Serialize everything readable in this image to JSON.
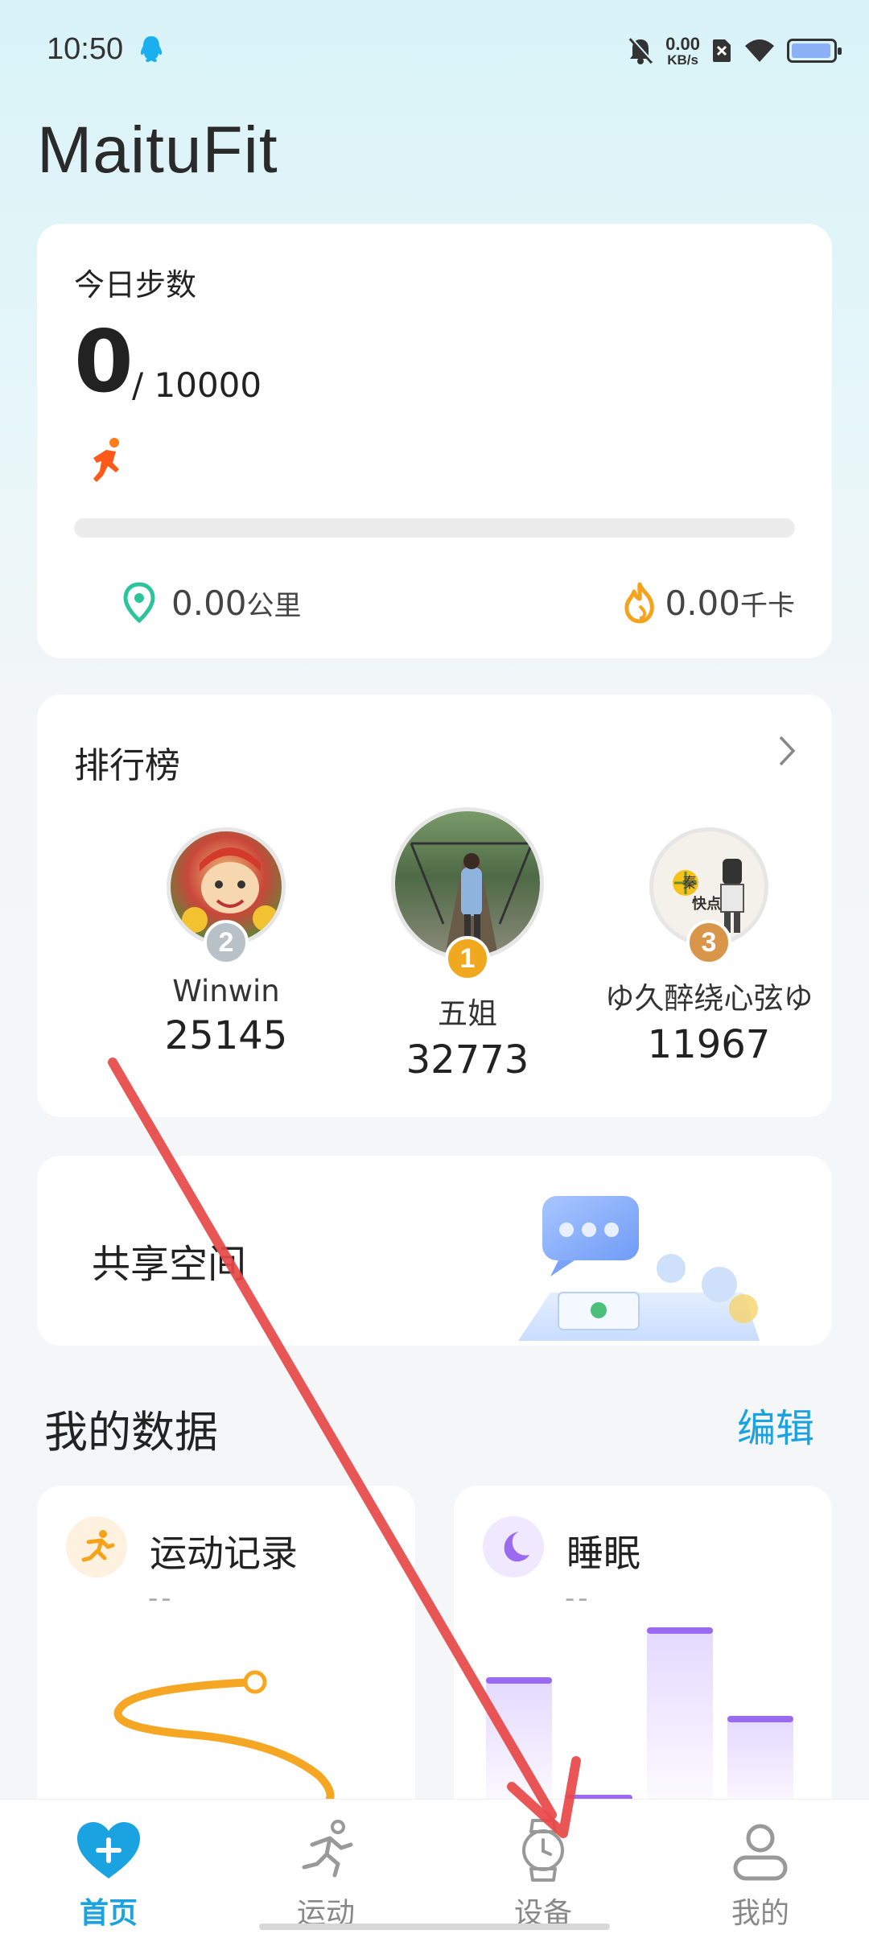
{
  "status_bar": {
    "time": "10:50",
    "net_speed_value": "0.00",
    "net_speed_unit": "KB/s",
    "icons": [
      "qq-icon",
      "mute-icon",
      "sim-x-icon",
      "wifi-icon",
      "battery-icon"
    ]
  },
  "app": {
    "title": "MaituFit"
  },
  "steps": {
    "label": "今日步数",
    "value": "0",
    "goal": "/ 10000",
    "progress_fraction": 0,
    "distance_value": "0.00",
    "distance_unit": "公里",
    "calories_value": "0.00",
    "calories_unit": "千卡"
  },
  "ranking": {
    "title": "排行榜",
    "entries": [
      {
        "rank": "2",
        "name": "Winwin",
        "steps": "25145"
      },
      {
        "rank": "1",
        "name": "五姐",
        "steps": "32773"
      },
      {
        "rank": "3",
        "name": "ゆ久醉绕心弦ゆ",
        "steps": "11967"
      }
    ],
    "avatar_text": {
      "badge": "秦",
      "caption": "快点"
    }
  },
  "share": {
    "title": "共享空间"
  },
  "my_data": {
    "title": "我的数据",
    "edit_label": "编辑",
    "cards": [
      {
        "title": "运动记录",
        "value": "--"
      },
      {
        "title": "睡眠",
        "value": "--"
      }
    ]
  },
  "nav": {
    "items": [
      {
        "label": "首页",
        "icon": "heart-plus-icon",
        "active": true
      },
      {
        "label": "运动",
        "icon": "running-icon",
        "active": false
      },
      {
        "label": "设备",
        "icon": "watch-icon",
        "active": false
      },
      {
        "label": "我的",
        "icon": "user-icon",
        "active": false
      }
    ]
  },
  "colors": {
    "accent": "#1aa3e0",
    "orange": "#ff8c2e",
    "purple": "#9a6bf0",
    "annotation_arrow": "#e84848"
  }
}
